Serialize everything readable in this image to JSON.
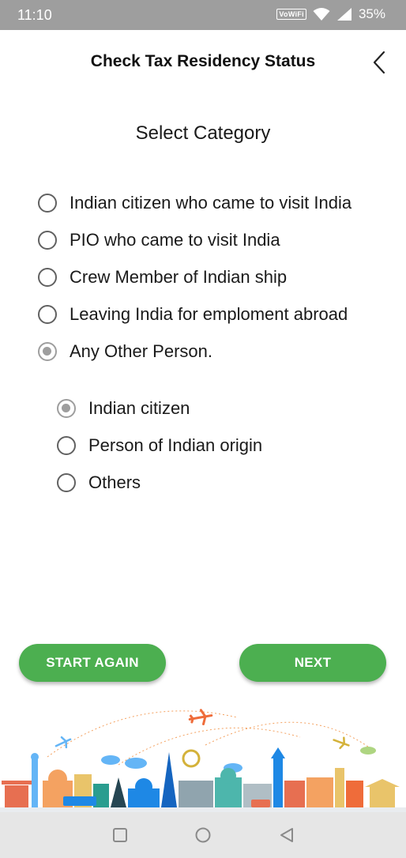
{
  "status_bar": {
    "time": "11:10",
    "vowifi": "VoWiFi",
    "battery": "35%"
  },
  "header": {
    "title": "Check Tax Residency Status"
  },
  "section_title": "Select Category",
  "categories": [
    {
      "label": "Indian citizen who came to visit India",
      "selected": false
    },
    {
      "label": "PIO who came to visit India",
      "selected": false
    },
    {
      "label": "Crew Member of Indian ship",
      "selected": false
    },
    {
      "label": "Leaving India for emploment abroad",
      "selected": false
    },
    {
      "label": "Any Other Person.",
      "selected": true
    }
  ],
  "subcategories": [
    {
      "label": "Indian citizen",
      "selected": true
    },
    {
      "label": "Person of Indian origin",
      "selected": false
    },
    {
      "label": "Others",
      "selected": false
    }
  ],
  "buttons": {
    "start_again": "START AGAIN",
    "next": "NEXT"
  },
  "colors": {
    "accent_green": "#4caf50",
    "radio_checked": "#9e9e9e",
    "status_bar": "#9e9e9e"
  },
  "icons": [
    "back-chevron-icon",
    "wifi-icon",
    "signal-icon",
    "nav-recents-icon",
    "nav-home-icon",
    "nav-back-icon"
  ]
}
